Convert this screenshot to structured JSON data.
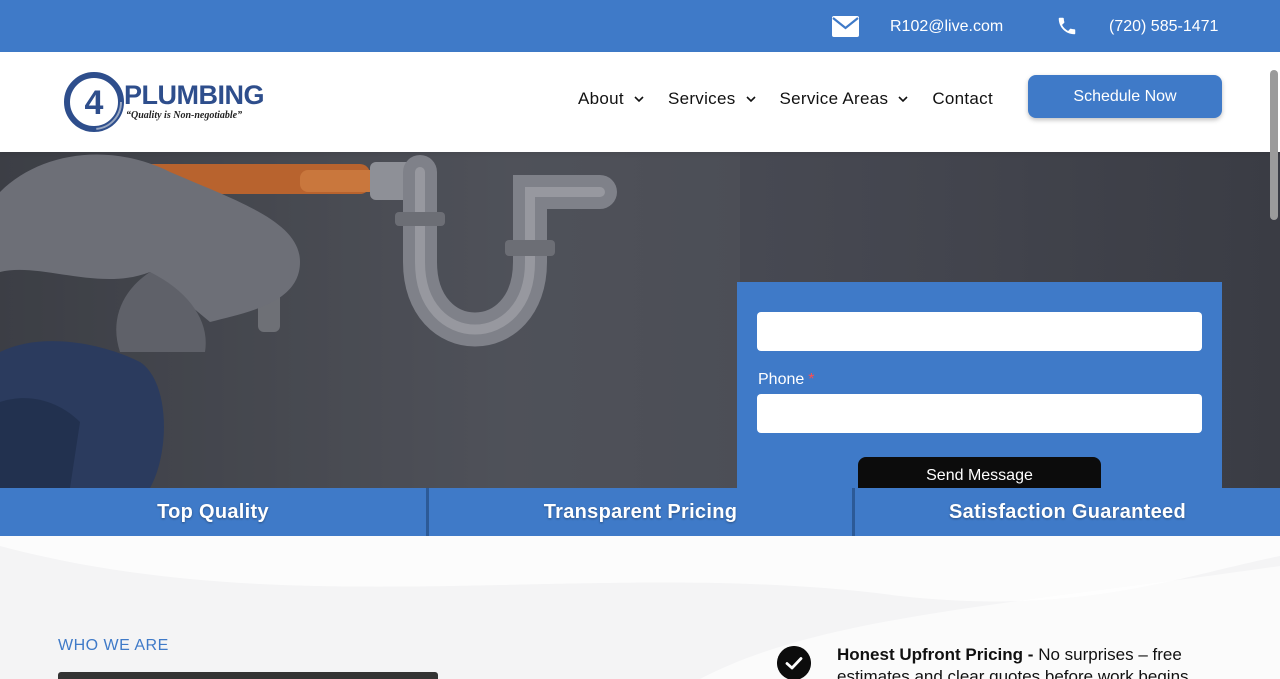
{
  "topbar": {
    "email": "R102@live.com",
    "phone": "(720) 585-1471",
    "email_icon": "envelope-icon",
    "phone_icon": "phone-icon"
  },
  "header": {
    "logo": {
      "mark": "4",
      "brand": "PLUMBING",
      "tagline": "“Quality is Non-negotiable”"
    },
    "nav": [
      {
        "label": "About",
        "has_dropdown": true
      },
      {
        "label": "Services",
        "has_dropdown": true
      },
      {
        "label": "Service Areas",
        "has_dropdown": true
      },
      {
        "label": "Contact",
        "has_dropdown": false
      }
    ],
    "cta_label": "Schedule Now"
  },
  "form": {
    "phone_label": "Phone",
    "required_mark": "*",
    "name_value": "",
    "phone_value": "",
    "submit_label": "Send Message"
  },
  "features": [
    "Top Quality",
    "Transparent Pricing",
    "Satisfaction Guaranteed"
  ],
  "about": {
    "eyebrow": "WHO WE ARE",
    "benefit_title": "Honest Upfront Pricing -",
    "benefit_text": "No surprises – free estimates and clear quotes before work begins."
  },
  "colors": {
    "brand_blue": "#3f7ac8",
    "dark": "#0c0c0c",
    "logo_navy": "#2e4e8c"
  }
}
